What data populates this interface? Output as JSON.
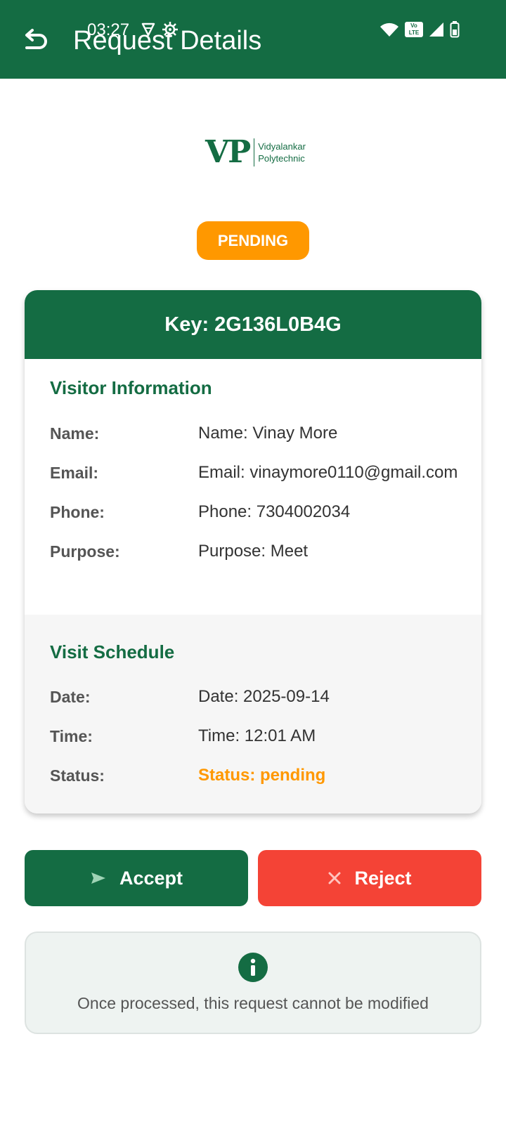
{
  "status_bar": {
    "time": "03:27",
    "network_label": "Vo LTE"
  },
  "appbar": {
    "title": "Request Details"
  },
  "logo": {
    "mark": "VP",
    "line1": "Vidyalankar",
    "line2": "Polytechnic"
  },
  "status_pill": {
    "label": "PENDING",
    "color": "#ff9800"
  },
  "card": {
    "header": "Key: 2G136L0B4G",
    "visitor": {
      "title": "Visitor Information",
      "rows": [
        {
          "label": "Name:",
          "value": "Name: Vinay More"
        },
        {
          "label": "Email:",
          "value": "Email: vinaymore0110@gmail.com"
        },
        {
          "label": "Phone:",
          "value": "Phone: 7304002034"
        },
        {
          "label": "Purpose:",
          "value": "Purpose: Meet"
        }
      ]
    },
    "schedule": {
      "title": "Visit Schedule",
      "rows": [
        {
          "label": "Date:",
          "value": "Date: 2025-09-14"
        },
        {
          "label": "Time:",
          "value": "Time: 12:01 AM"
        },
        {
          "label": "Status:",
          "value": "Status: pending"
        }
      ]
    }
  },
  "actions": {
    "accept_label": "Accept",
    "reject_label": "Reject"
  },
  "info": {
    "text": "Once processed, this request cannot be modified"
  },
  "colors": {
    "primary": "#146c43",
    "pending": "#ff9800",
    "reject": "#f44336"
  },
  "icons": {
    "back": "back-arrow-icon",
    "accept": "send-icon",
    "reject": "close-icon",
    "info": "info-icon"
  }
}
